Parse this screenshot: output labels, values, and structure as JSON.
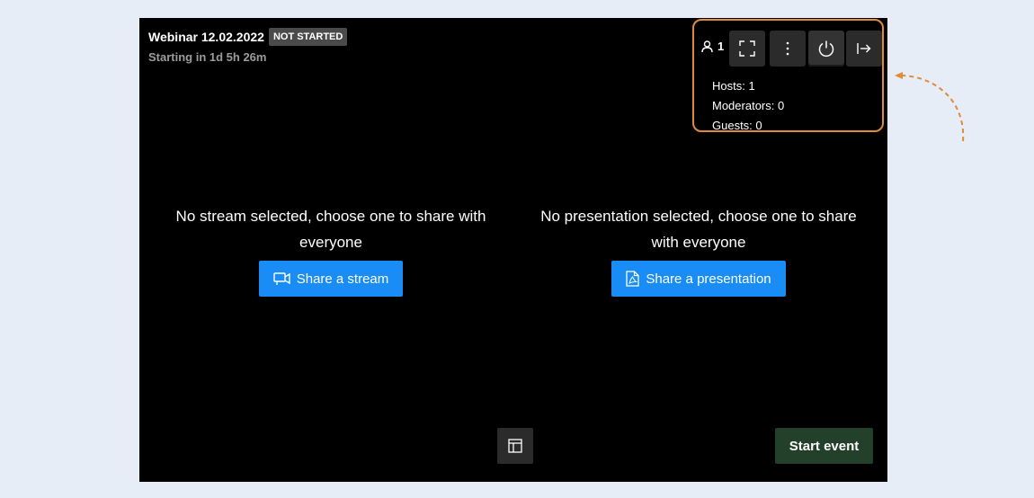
{
  "event": {
    "title": "Webinar 12.02.2022",
    "status": "NOT STARTED",
    "countdown": "Starting in 1d 5h 26m"
  },
  "controls": {
    "participant_count": "1",
    "icons": [
      "user-icon",
      "fullscreen-icon",
      "more-vertical-icon",
      "power-icon",
      "exit-icon"
    ],
    "counts": {
      "hosts": "Hosts: 1",
      "moderators": "Moderators: 0",
      "guests": "Guests: 0"
    }
  },
  "stream": {
    "message": "No stream selected, choose one to share with everyone",
    "button_label": "Share a stream"
  },
  "presentation": {
    "message": "No presentation selected, choose one to share with everyone",
    "button_label": "Share a presentation"
  },
  "footer": {
    "start_label": "Start event"
  },
  "colors": {
    "accent_blue": "#1a8cf5",
    "start_green": "#22402a",
    "highlight_orange": "#e08a3c",
    "background": "#000000"
  }
}
